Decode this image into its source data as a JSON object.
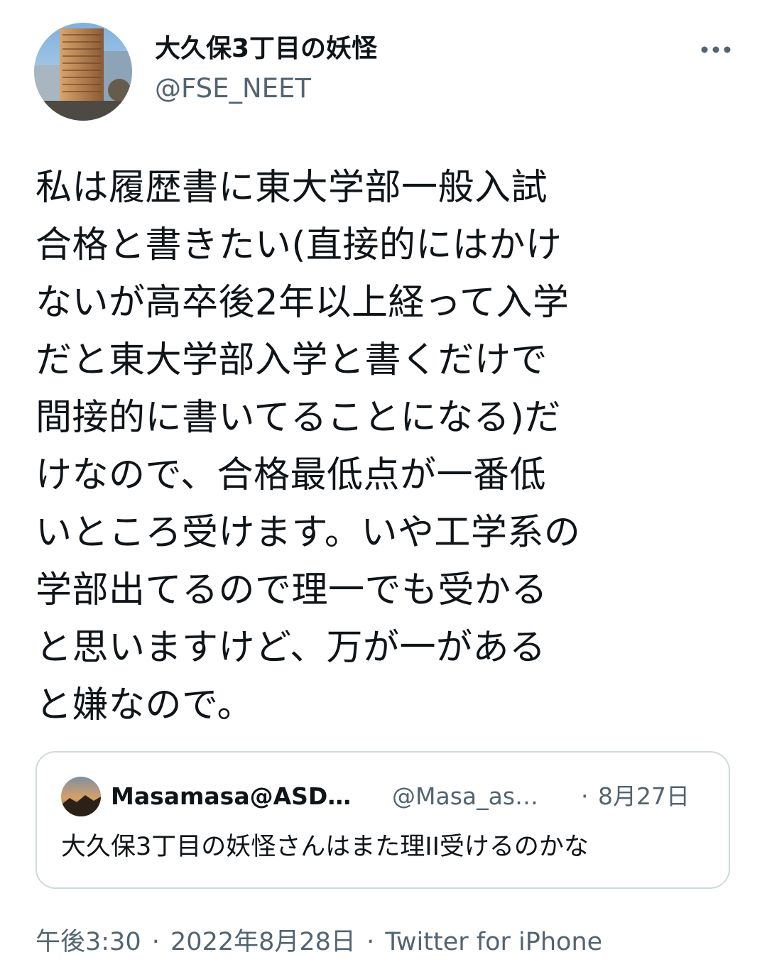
{
  "author": {
    "display_name": "大久保3丁目の妖怪",
    "handle": "@FSE_NEET"
  },
  "header": {
    "more_icon": "more-horizontal-icon"
  },
  "tweet": {
    "lines": [
      "私は履歴書に東大学部一般入試",
      "合格と書きたい(直接的にはかけ",
      "ないが高卒後2年以上経って入学",
      "だと東大学部入学と書くだけで",
      "間接的に書いてることになる)だ",
      "けなので、合格最低点が一番低",
      "いところ受けます。いや工学系の",
      "学部出てるので理一でも受かる",
      "と思いますけど、万が一がある",
      "と嫌なので。"
    ]
  },
  "quote": {
    "display_name": "Masamasa@ASD…",
    "handle": "@Masa_as…",
    "separator": "·",
    "date": "8月27日",
    "text": "大久保3丁目の妖怪さんはまた理II受けるのかな"
  },
  "meta": {
    "time": "午後3:30",
    "separator": "·",
    "date": "2022年8月28日",
    "source": "Twitter for iPhone"
  },
  "colors": {
    "text_primary": "#0f1419",
    "text_secondary": "#536471",
    "border": "#cfd9de"
  }
}
